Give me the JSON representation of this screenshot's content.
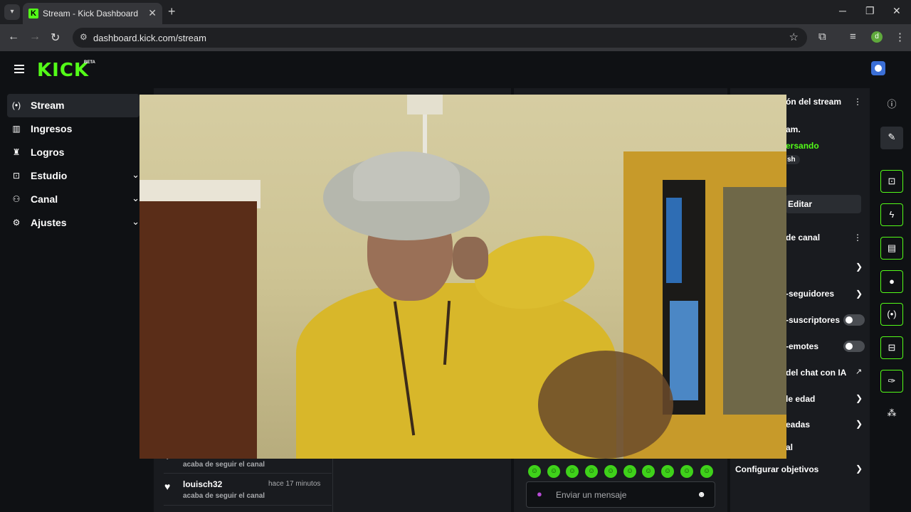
{
  "browser": {
    "tab_title": "Stream - Kick Dashboard",
    "url": "dashboard.kick.com/stream",
    "profile_initial": "d"
  },
  "app": {
    "logo": "KICK",
    "logo_badge": "BETA"
  },
  "sidebar": {
    "items": [
      {
        "label": "Stream",
        "icon": "stream-icon",
        "active": true
      },
      {
        "label": "Ingresos",
        "icon": "bar-chart-icon"
      },
      {
        "label": "Logros",
        "icon": "trophy-icon"
      },
      {
        "label": "Estudio",
        "icon": "studio-icon",
        "expandable": true
      },
      {
        "label": "Canal",
        "icon": "channel-icon",
        "expandable": true
      },
      {
        "label": "Ajustes",
        "icon": "gear-icon",
        "expandable": true
      }
    ]
  },
  "stream_info": {
    "title_partial": "ón del stream",
    "line1": "am.",
    "line2": "ersando",
    "tag": "sh",
    "edit_label": "Editar"
  },
  "channel_settings": {
    "title_partial": "de canal",
    "rows": [
      {
        "label": "",
        "control": "chevron"
      },
      {
        "label": "-seguidores",
        "control": "chevron"
      },
      {
        "label": "-suscriptores",
        "control": "toggle",
        "on": false
      },
      {
        "label": "-emotes",
        "control": "toggle",
        "on": false
      },
      {
        "label": "del chat con IA",
        "control": "external"
      },
      {
        "label": "le edad",
        "control": "chevron"
      },
      {
        "label": "eadas",
        "control": "chevron"
      },
      {
        "label": "al",
        "control": "none"
      }
    ],
    "goals_label": "Configurar objetivos"
  },
  "activity_feed": [
    {
      "sub": "acaba de seguir el canal"
    },
    {
      "user": "louisch32",
      "time": "hace 17 minutos",
      "sub": "acaba de seguir el canal"
    }
  ],
  "chat": {
    "placeholder": "Enviar un mensaje"
  },
  "colors": {
    "accent": "#53fc18",
    "background": "#0f1114",
    "panel": "#191b1f"
  }
}
